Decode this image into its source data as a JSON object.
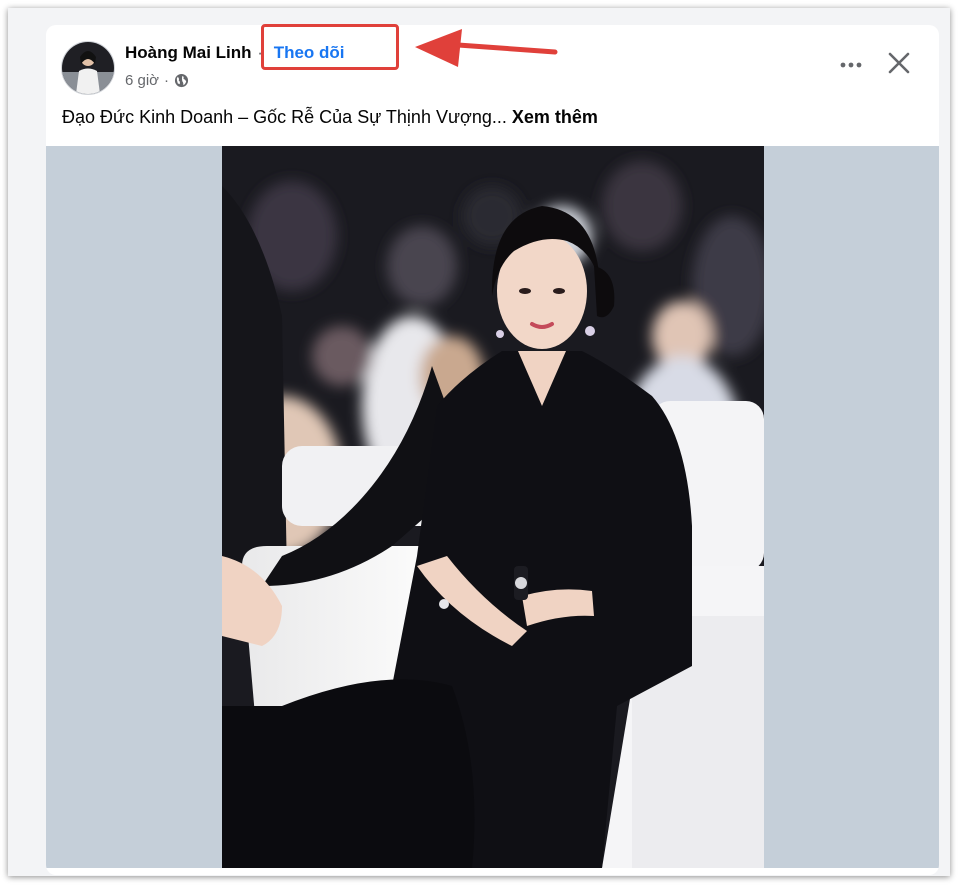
{
  "post": {
    "author": "Hoàng Mai Linh",
    "separator": "·",
    "follow_label": "Theo dõi",
    "time": "6 giờ",
    "time_separator": "·",
    "privacy_icon": "globe-icon",
    "caption": "Đạo Đức Kinh Doanh – Gốc Rễ Của Sự Thịnh Vượng...",
    "see_more_label": "Xem thêm",
    "menu_icon": "more-options-icon",
    "close_icon": "close-icon"
  },
  "annotation": {
    "box_color": "#e0403a",
    "arrow_color": "#e0403a"
  },
  "colors": {
    "link_blue": "#1876f2",
    "text_primary": "#050505",
    "text_secondary": "#65676b",
    "media_background": "#c5cfd9"
  }
}
